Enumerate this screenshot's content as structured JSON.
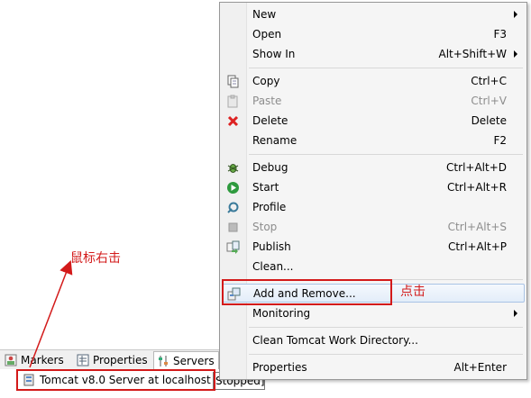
{
  "views": {
    "tabs": [
      {
        "label": "Markers",
        "icon": "markers-icon"
      },
      {
        "label": "Properties",
        "icon": "properties-icon"
      },
      {
        "label": "Servers",
        "icon": "servers-icon"
      }
    ],
    "server": {
      "label": "Tomcat v8.0 Server at localhost",
      "status": "Stopped]"
    }
  },
  "annotations": {
    "right_click": "鼠标右击",
    "click": "点击",
    "color": "#d31a1a"
  },
  "menu": {
    "items": [
      {
        "label": "New",
        "shortcut": "",
        "submenu": true
      },
      {
        "label": "Open",
        "shortcut": "F3"
      },
      {
        "label": "Show In",
        "shortcut": "Alt+Shift+W",
        "submenu": true
      },
      {
        "label": "Copy",
        "shortcut": "Ctrl+C",
        "icon": "copy-icon"
      },
      {
        "label": "Paste",
        "shortcut": "Ctrl+V",
        "icon": "paste-icon",
        "disabled": true
      },
      {
        "label": "Delete",
        "shortcut": "Delete",
        "icon": "delete-icon"
      },
      {
        "label": "Rename",
        "shortcut": "F2"
      },
      {
        "label": "Debug",
        "shortcut": "Ctrl+Alt+D",
        "icon": "debug-icon"
      },
      {
        "label": "Start",
        "shortcut": "Ctrl+Alt+R",
        "icon": "start-icon"
      },
      {
        "label": "Profile",
        "shortcut": "",
        "icon": "profile-icon"
      },
      {
        "label": "Stop",
        "shortcut": "Ctrl+Alt+S",
        "icon": "stop-icon",
        "disabled": true
      },
      {
        "label": "Publish",
        "shortcut": "Ctrl+Alt+P",
        "icon": "publish-icon"
      },
      {
        "label": "Clean...",
        "shortcut": ""
      },
      {
        "label": "Add and Remove...",
        "shortcut": "",
        "icon": "add-remove-icon",
        "highlighted": true
      },
      {
        "label": "Monitoring",
        "shortcut": "",
        "submenu": true
      },
      {
        "label": "Clean Tomcat Work Directory...",
        "shortcut": ""
      },
      {
        "label": "Properties",
        "shortcut": "Alt+Enter"
      }
    ]
  }
}
